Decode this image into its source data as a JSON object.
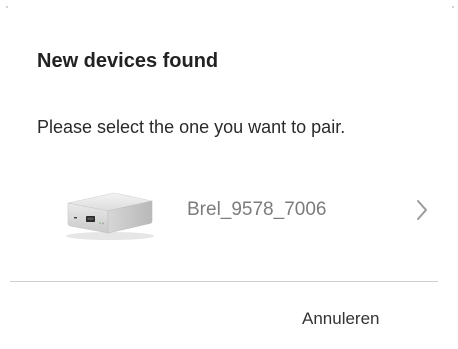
{
  "dialog": {
    "title": "New devices found",
    "subtitle": "Please select the one you want to pair.",
    "devices": [
      {
        "name": "Brel_9578_7006",
        "icon": "hub-device-icon"
      }
    ],
    "cancel_label": "Annuleren"
  },
  "colors": {
    "background": "#ffffff",
    "title_text": "#222222",
    "device_name_text": "#7c7c7c",
    "divider": "#cfcfcf",
    "chevron": "#9a9a9a"
  }
}
